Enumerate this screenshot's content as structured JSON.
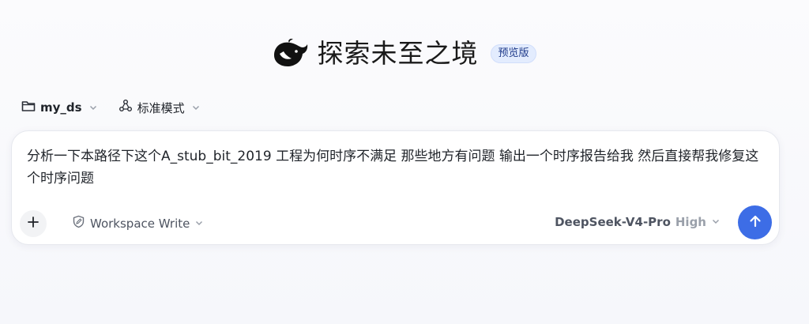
{
  "header": {
    "title": "探索未至之境",
    "badge": "预览版",
    "logo_icon": "whale-logo-icon"
  },
  "selectors": {
    "workspace": {
      "label": "my_ds",
      "icon": "folder-icon"
    },
    "mode": {
      "label": "标准模式",
      "icon": "nodes-icon"
    }
  },
  "composer": {
    "prompt_text": "分析一下本路径下这个A_stub_bit_2019  工程为何时序不满足 那些地方有问题 输出一个时序报告给我 然后直接帮我修复这个时序问题",
    "permission_label": "Workspace Write",
    "permission_icon": "shield-edit-icon",
    "model_name": "DeepSeek-V4-Pro",
    "effort": "High",
    "add_icon": "plus-icon",
    "send_icon": "arrow-up-icon"
  },
  "colors": {
    "accent": "#3d6de6",
    "badge_bg": "#e3ecfe",
    "badge_text": "#1f3a8a"
  }
}
